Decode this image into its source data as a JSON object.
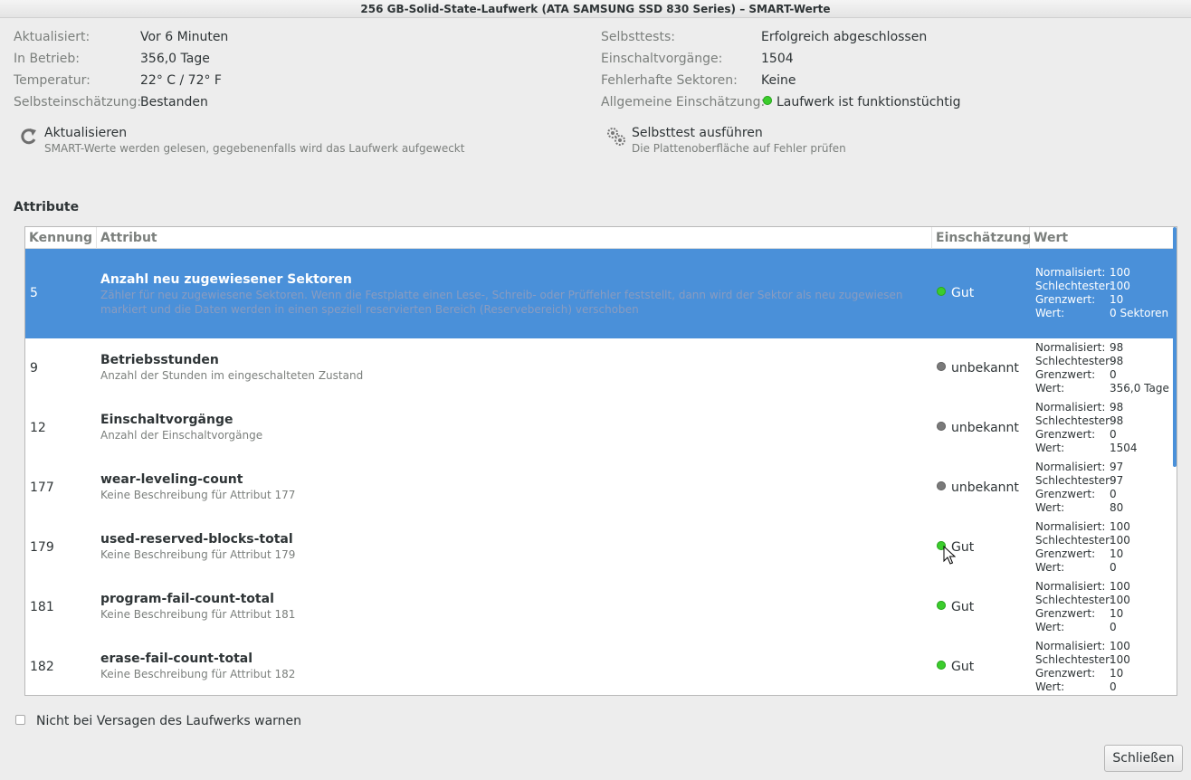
{
  "window": {
    "title": "256 GB-Solid-State-Laufwerk (ATA SAMSUNG SSD 830 Series) – SMART-Werte"
  },
  "info_left": [
    {
      "label": "Aktualisiert:",
      "value": "Vor 6 Minuten"
    },
    {
      "label": "In Betrieb:",
      "value": "356,0 Tage"
    },
    {
      "label": "Temperatur:",
      "value": "22° C / 72° F"
    },
    {
      "label": "Selbsteinschätzung:",
      "value": "Bestanden"
    }
  ],
  "info_right": [
    {
      "label": "Selbsttests:",
      "value": "Erfolgreich abgeschlossen"
    },
    {
      "label": "Einschaltvorgänge:",
      "value": "1504"
    },
    {
      "label": "Fehlerhafte Sektoren:",
      "value": "Keine"
    },
    {
      "label": "Allgemeine Einschätzung:",
      "value": "Laufwerk ist funktionstüchtig",
      "status_color": "#3bcd2c"
    }
  ],
  "actions": {
    "refresh": {
      "title": "Aktualisieren",
      "desc": "SMART-Werte werden gelesen, gegebenenfalls wird das Laufwerk aufgeweckt",
      "icon": "refresh-icon"
    },
    "selftest": {
      "title": "Selbsttest ausführen",
      "desc": "Die Plattenoberfläche auf Fehler prüfen",
      "icon": "gears-icon"
    }
  },
  "attributes": {
    "section_title": "Attribute",
    "columns": [
      "Kennung",
      "Attribut",
      "Einschätzung",
      "Wert"
    ],
    "value_keys": [
      "Normalisiert:",
      "Schlechtester:",
      "Grenzwert:",
      "Wert:"
    ],
    "rows": [
      {
        "id": "5",
        "name": "Anzahl neu zugewiesener Sektoren",
        "desc": "Zähler für neu zugewiesene Sektoren. Wenn die Festplatte einen Lese-, Schreib- oder Prüffehler feststellt, dann wird der Sektor als neu zugewiesen markiert und die Daten werden in einen speziell reservierten Bereich (Reservebereich) verschoben",
        "state": "Gut",
        "state_color": "green",
        "normalized": "100",
        "worst": "100",
        "threshold": "10",
        "value": "0 Sektoren",
        "selected": true
      },
      {
        "id": "9",
        "name": "Betriebsstunden",
        "desc": "Anzahl der Stunden im eingeschalteten Zustand",
        "state": "unbekannt",
        "state_color": "grey",
        "normalized": "98",
        "worst": "98",
        "threshold": "0",
        "value": "356,0 Tage"
      },
      {
        "id": "12",
        "name": "Einschaltvorgänge",
        "desc": "Anzahl der Einschaltvorgänge",
        "state": "unbekannt",
        "state_color": "grey",
        "normalized": "98",
        "worst": "98",
        "threshold": "0",
        "value": "1504"
      },
      {
        "id": "177",
        "name": "wear-leveling-count",
        "desc": "Keine Beschreibung für Attribut 177",
        "state": "unbekannt",
        "state_color": "grey",
        "normalized": "97",
        "worst": "97",
        "threshold": "0",
        "value": "80"
      },
      {
        "id": "179",
        "name": "used-reserved-blocks-total",
        "desc": "Keine Beschreibung für Attribut 179",
        "state": "Gut",
        "state_color": "green",
        "normalized": "100",
        "worst": "100",
        "threshold": "10",
        "value": "0"
      },
      {
        "id": "181",
        "name": "program-fail-count-total",
        "desc": "Keine Beschreibung für Attribut 181",
        "state": "Gut",
        "state_color": "green",
        "normalized": "100",
        "worst": "100",
        "threshold": "10",
        "value": "0"
      },
      {
        "id": "182",
        "name": "erase-fail-count-total",
        "desc": "Keine Beschreibung für Attribut 182",
        "state": "Gut",
        "state_color": "green",
        "normalized": "100",
        "worst": "100",
        "threshold": "10",
        "value": "0"
      }
    ]
  },
  "footer": {
    "checkbox_label": "Nicht bei Versagen des Laufwerks warnen",
    "close_label": "Schließen"
  }
}
